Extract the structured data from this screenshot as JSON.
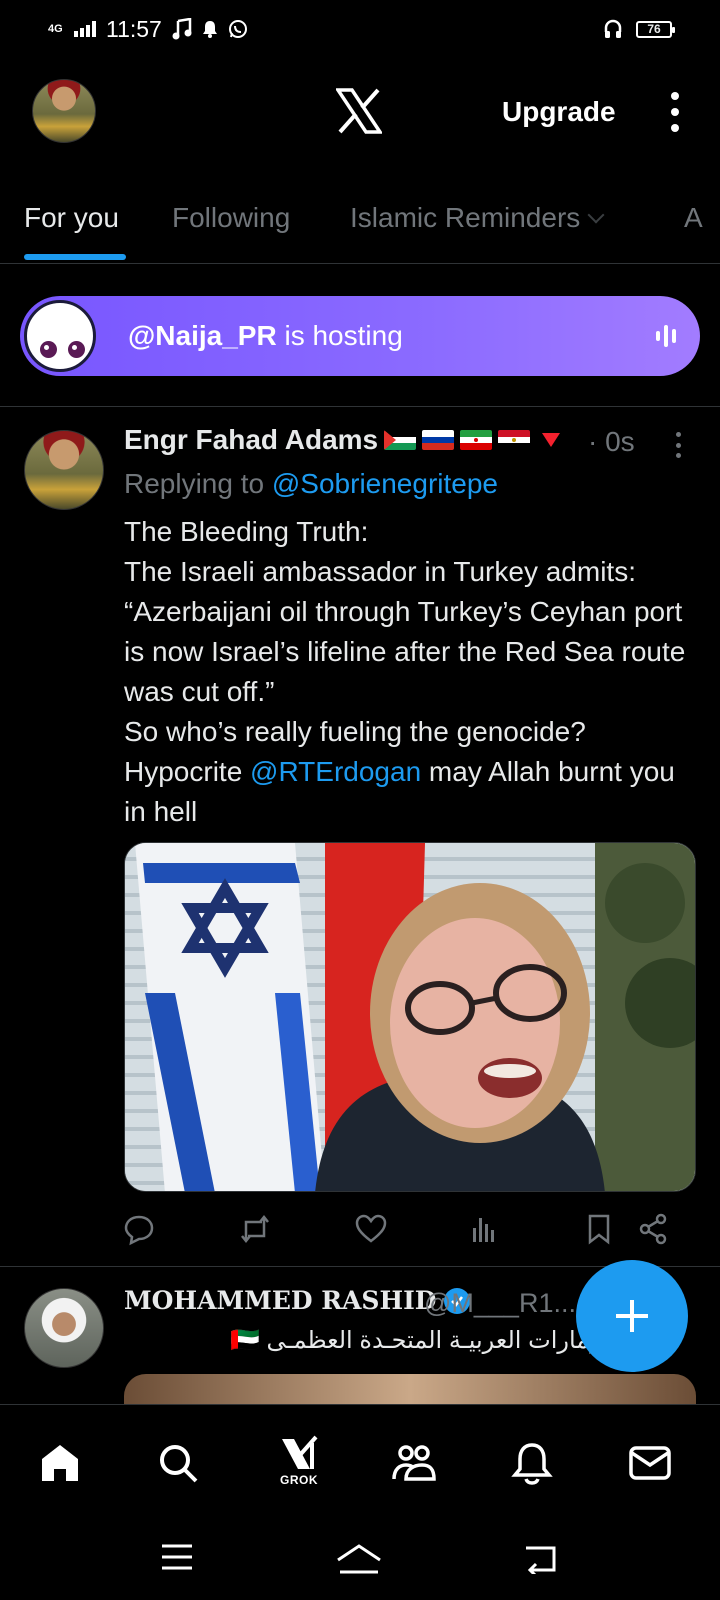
{
  "status_bar": {
    "time": "11:57",
    "network": "4G",
    "battery": "76"
  },
  "header": {
    "logo": "X",
    "upgrade_label": "Upgrade"
  },
  "tabs": [
    {
      "label": "For you",
      "active": true
    },
    {
      "label": "Following",
      "active": false
    },
    {
      "label": "Islamic Reminders",
      "active": false
    },
    {
      "label": "A",
      "active": false
    }
  ],
  "space": {
    "host": "@Naija_PR",
    "suffix": " is hosting"
  },
  "tweet1": {
    "author": "Engr Fahad Adams",
    "time": "· 0s",
    "replying_prefix": "Replying to ",
    "replying_to": "@Sobrienegritepe",
    "lines": [
      "The Bleeding Truth:",
      "The Israeli ambassador in Turkey admits:",
      "“Azerbaijani oil through Turkey’s Ceyhan port is now Israel’s lifeline after the Red Sea route was cut off.”",
      "So who’s really fueling the genocide?"
    ],
    "last_pre": "Hypocrite ",
    "last_mention": "@RTErdogan",
    "last_post": " may Allah burnt you in hell"
  },
  "tweet2": {
    "author": "MOHAMMED RASHID",
    "handle": "@M___R1...",
    "bio": "دولة الإمارات العربيـة المتحـدة العظمـى 🇦🇪"
  },
  "bottom_nav": {
    "grok_label": "GROK"
  },
  "colors": {
    "accent": "#1d9bf0",
    "space_gradient_start": "#7856ff",
    "background": "#000000",
    "muted_text": "#71767b"
  }
}
